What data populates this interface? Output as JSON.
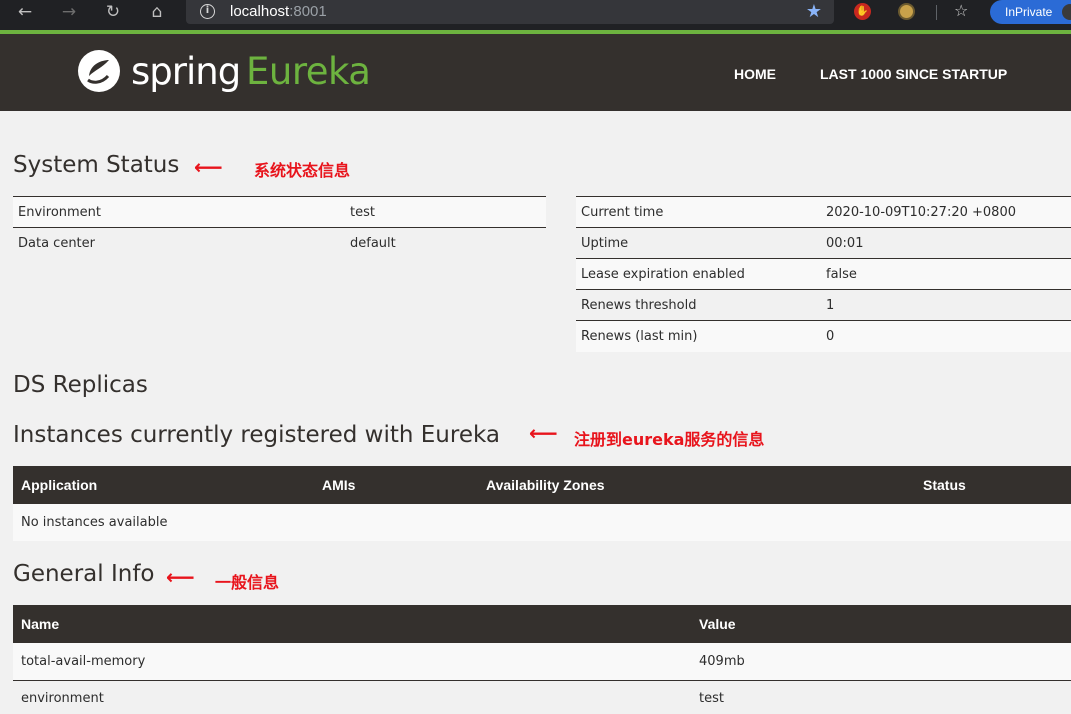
{
  "browser": {
    "url_host": "localhost",
    "url_port": ":8001",
    "inprivate_label": "InPrivate"
  },
  "nav": {
    "brand_spring": "spring",
    "brand_eureka": "Eureka",
    "home": "HOME",
    "last1000": "LAST 1000 SINCE STARTUP"
  },
  "system_status": {
    "title": "System Status",
    "annotation": "系统状态信息",
    "left": [
      {
        "label": "Environment",
        "value": "test"
      },
      {
        "label": "Data center",
        "value": "default"
      }
    ],
    "right": [
      {
        "label": "Current time",
        "value": "2020-10-09T10:27:20 +0800"
      },
      {
        "label": "Uptime",
        "value": "00:01"
      },
      {
        "label": "Lease expiration enabled",
        "value": "false"
      },
      {
        "label": "Renews threshold",
        "value": "1"
      },
      {
        "label": "Renews (last min)",
        "value": "0"
      }
    ]
  },
  "ds_replicas": {
    "title": "DS Replicas"
  },
  "instances": {
    "title": "Instances currently registered with Eureka",
    "annotation": "注册到eureka服务的信息",
    "headers": [
      "Application",
      "AMIs",
      "Availability Zones",
      "Status"
    ],
    "empty_text": "No instances available"
  },
  "general_info": {
    "title": "General Info",
    "annotation": "一般信息",
    "headers": [
      "Name",
      "Value"
    ],
    "rows": [
      {
        "name": "total-avail-memory",
        "value": "409mb"
      },
      {
        "name": "environment",
        "value": "test"
      }
    ]
  },
  "colors": {
    "nav_bg": "#34302d",
    "spring_green": "#6db33f",
    "annotation_red": "#e8141c"
  }
}
